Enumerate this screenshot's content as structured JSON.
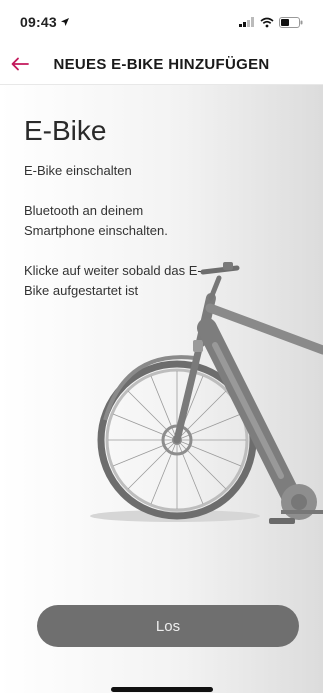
{
  "status": {
    "time": "09:43"
  },
  "header": {
    "title": "NEUES E-BIKE HINZUFÜGEN"
  },
  "main": {
    "heading": "E-Bike",
    "steps": [
      "E-Bike einschalten",
      "Bluetooth an deinem Smartphone einschalten.",
      "Klicke auf weiter sobald das E-Bike aufgestartet ist"
    ],
    "button_label": "Los"
  },
  "colors": {
    "accent": "#c2185b",
    "button": "#6f6f6f"
  },
  "icons": [
    "location-arrow-icon",
    "signal-icon",
    "wifi-icon",
    "battery-icon",
    "back-arrow-icon"
  ]
}
